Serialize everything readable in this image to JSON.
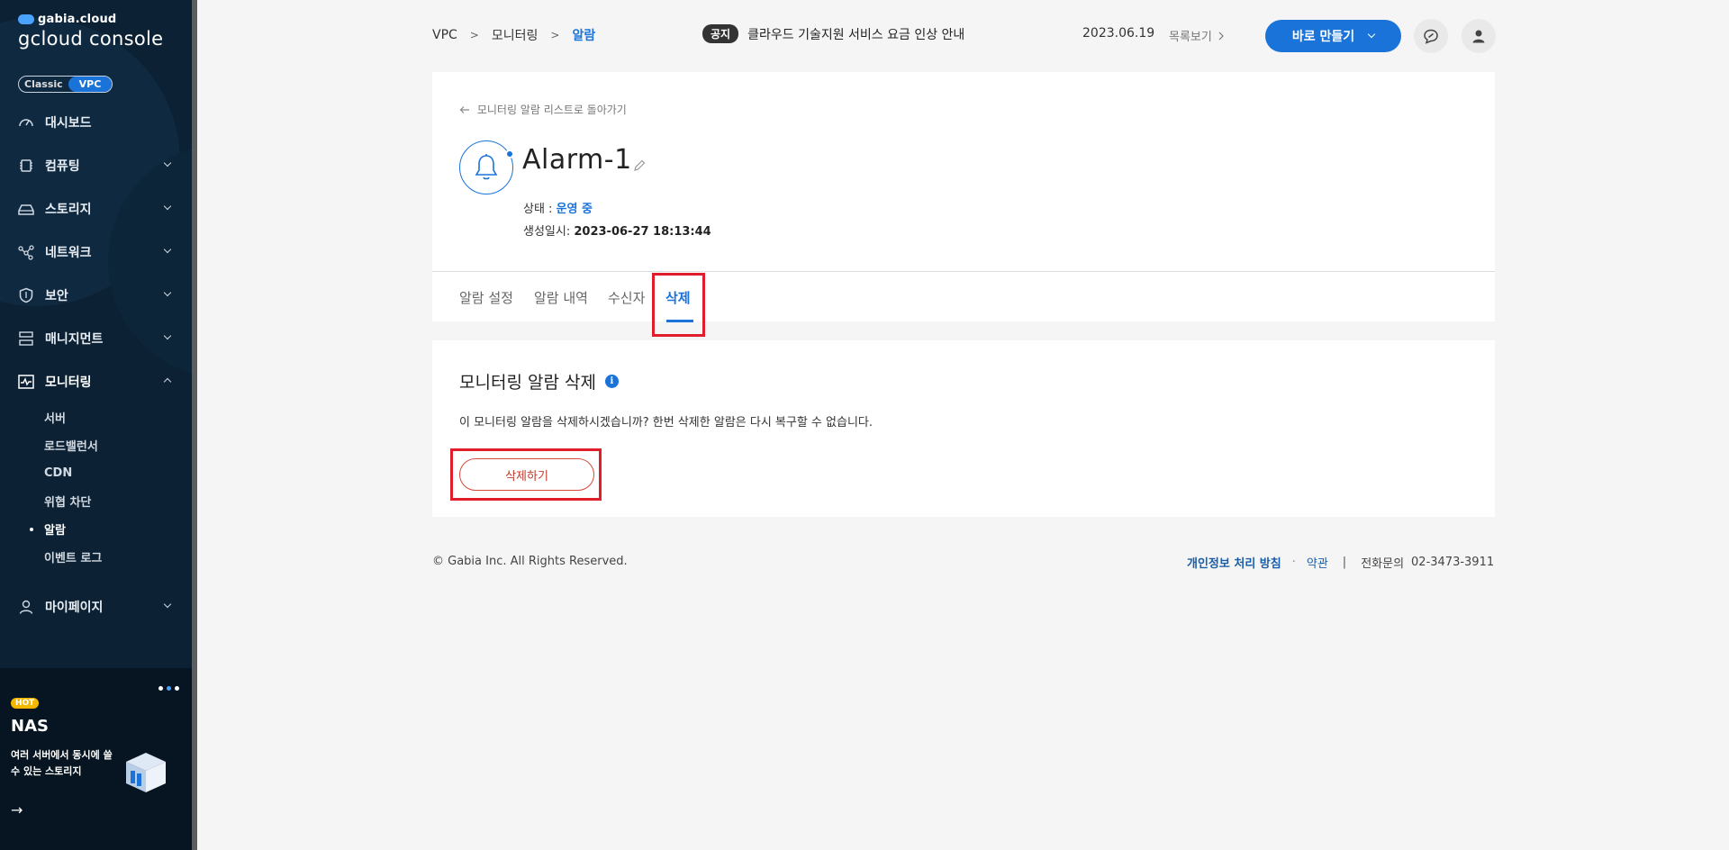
{
  "sidebar": {
    "brand_top": "gabia.cloud",
    "brand_main": "gcloud console",
    "toggle": {
      "classic": "Classic",
      "vpc": "VPC"
    },
    "items": [
      {
        "label": "대시보드"
      },
      {
        "label": "컴퓨팅"
      },
      {
        "label": "스토리지"
      },
      {
        "label": "네트워크"
      },
      {
        "label": "보안"
      },
      {
        "label": "매니지먼트"
      },
      {
        "label": "모니터링"
      },
      {
        "label": "마이페이지"
      }
    ],
    "monitoring_sub": [
      {
        "label": "서버"
      },
      {
        "label": "로드밸런서"
      },
      {
        "label": "CDN"
      },
      {
        "label": "위협 차단"
      },
      {
        "label": "알람"
      },
      {
        "label": "이벤트 로그"
      }
    ],
    "banner": {
      "badge": "HOT",
      "title": "NAS",
      "desc": "여러 서버에서 동시에 쓸 수 있는 스토리지",
      "arrow": "→"
    }
  },
  "header": {
    "breadcrumb": [
      "VPC",
      "모니터링",
      "알람"
    ],
    "breadcrumb_sep": ">",
    "notice_badge": "공지",
    "notice_text": "클라우드 기술지원 서비스 요금 인상 안내",
    "notice_date": "2023.06.19",
    "notice_list": "목록보기",
    "create_label": "바로 만들기"
  },
  "detail": {
    "back_link": "모니터링 알람 리스트로 돌아가기",
    "name": "Alarm-1",
    "status_label": "상태 :",
    "status_value": "운영 중",
    "created_label": "생성일시:",
    "created_value": "2023-06-27 18:13:44",
    "tabs": [
      "알람 설정",
      "알람 내역",
      "수신자",
      "삭제"
    ]
  },
  "delete_section": {
    "title": "모니터링 알람 삭제",
    "info_icon": "i",
    "description": "이 모니터링 알람을 삭제하시겠습니까? 한번 삭제한 알람은 다시 복구할 수 없습니다.",
    "button": "삭제하기"
  },
  "footer": {
    "copyright": "© Gabia Inc. All Rights Reserved.",
    "privacy": "개인정보 처리 방침",
    "dot": "·",
    "terms": "약관",
    "bar": "|",
    "phone_label": "전화문의",
    "phone": "02-3473-3911"
  },
  "colors": {
    "accent": "#1a73d9",
    "sidebar_bg": "#0c2234",
    "highlight": "#e01e2b",
    "danger": "#d64a3c"
  }
}
